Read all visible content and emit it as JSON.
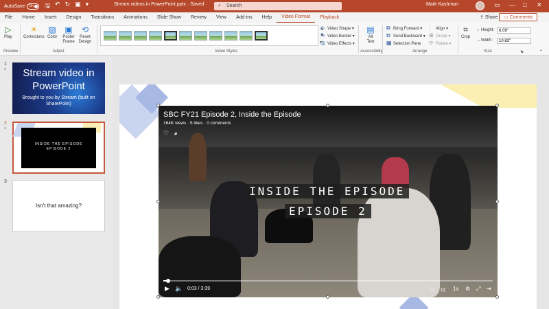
{
  "titlebar": {
    "autosave_label": "AutoSave",
    "autosave_state": "On",
    "document_title": "Stream videos in PowerPoint.pptx  ·  Saved  ·",
    "search_placeholder": "Search",
    "user_name": "Mark Kashman"
  },
  "tabs": [
    {
      "label": "File"
    },
    {
      "label": "Home"
    },
    {
      "label": "Insert"
    },
    {
      "label": "Design"
    },
    {
      "label": "Transitions"
    },
    {
      "label": "Animations"
    },
    {
      "label": "Slide Show"
    },
    {
      "label": "Review"
    },
    {
      "label": "View"
    },
    {
      "label": "Add-ins"
    },
    {
      "label": "Help"
    },
    {
      "label": "Video Format"
    },
    {
      "label": "Playback"
    }
  ],
  "share_label": "Share",
  "comments_label": "Comments",
  "ribbon": {
    "preview": {
      "group": "Preview",
      "play": "Play"
    },
    "adjust": {
      "group": "Adjust",
      "corrections": "Corrections",
      "color": "Color",
      "poster_frame": "Poster Frame",
      "reset_design": "Reset Design"
    },
    "video_styles": {
      "group": "Video Styles",
      "video_shape": "Video Shape",
      "video_border": "Video Border",
      "video_effects": "Video Effects"
    },
    "accessibility": {
      "group": "Accessibility",
      "alt_text": "Alt Text"
    },
    "arrange": {
      "group": "Arrange",
      "bring_forward": "Bring Forward",
      "send_backward": "Send Backward",
      "selection_pane": "Selection Pane",
      "align": "Align",
      "group_btn": "Group",
      "rotate": "Rotate"
    },
    "size": {
      "group": "Size",
      "crop": "Crop",
      "height_label": "Height:",
      "height_value": "6.09\"",
      "width_label": "Width:",
      "width_value": "10.83\""
    }
  },
  "slides": [
    {
      "number": "1",
      "title": "Stream video in PowerPoint",
      "subtitle": "Brought to you by Stream (built on SharePoint)"
    },
    {
      "number": "2",
      "line1": "INSIDE THE EPISODE",
      "line2": "EPISODE 2"
    },
    {
      "number": "3",
      "title": "Isn't that amazing?"
    }
  ],
  "video": {
    "title": "SBC FY21 Episode 2, Inside the Episode",
    "meta": "164K views · 5 likes · 0 comments",
    "overlay_line1": "INSIDE THE EPISODE",
    "overlay_line2": "EPISODE 2",
    "current_time": "0:03",
    "time_sep": "/",
    "duration": "3:39",
    "speed": "1x",
    "progress_fraction": 0.014
  }
}
